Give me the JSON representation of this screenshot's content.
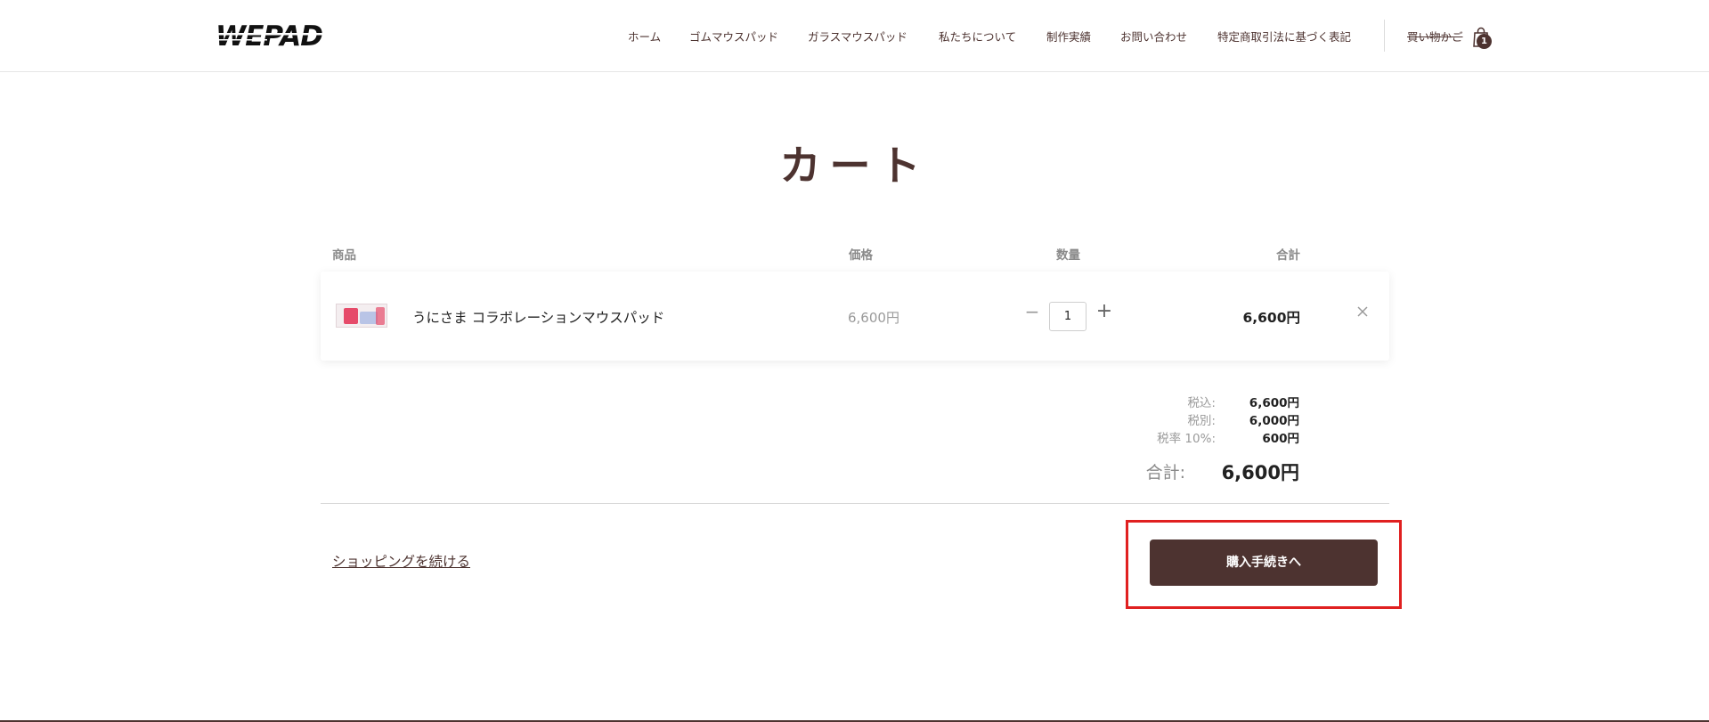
{
  "header": {
    "logo_text": "WEPAD",
    "nav": [
      "ホーム",
      "ゴムマウスパッド",
      "ガラスマウスパッド",
      "私たちについて",
      "制作実績",
      "お問い合わせ",
      "特定商取引法に基づく表記"
    ],
    "cart_label": "買い物かご",
    "cart_count": "1",
    "cart_icon": "shopping-bag-icon"
  },
  "page": {
    "title": "カート"
  },
  "table": {
    "headers": {
      "product": "商品",
      "price": "価格",
      "quantity": "数量",
      "total": "合計"
    }
  },
  "cart_items": [
    {
      "name": "うにさま コラボレーションマウスパッド",
      "price": "6,600円",
      "quantity": "1",
      "total": "6,600円"
    }
  ],
  "summary": {
    "tax_included_label": "税込:",
    "tax_included_value": "6,600円",
    "tax_excluded_label": "税別:",
    "tax_excluded_value": "6,000円",
    "tax_rate_label": "税率 10%:",
    "tax_rate_value": "600円",
    "total_label": "合計:",
    "total_value": "6,600円"
  },
  "actions": {
    "continue_shopping": "ショッピングを続ける",
    "checkout": "購入手続きへ"
  },
  "colors": {
    "brand": "#4d3330",
    "highlight": "#e02020"
  }
}
